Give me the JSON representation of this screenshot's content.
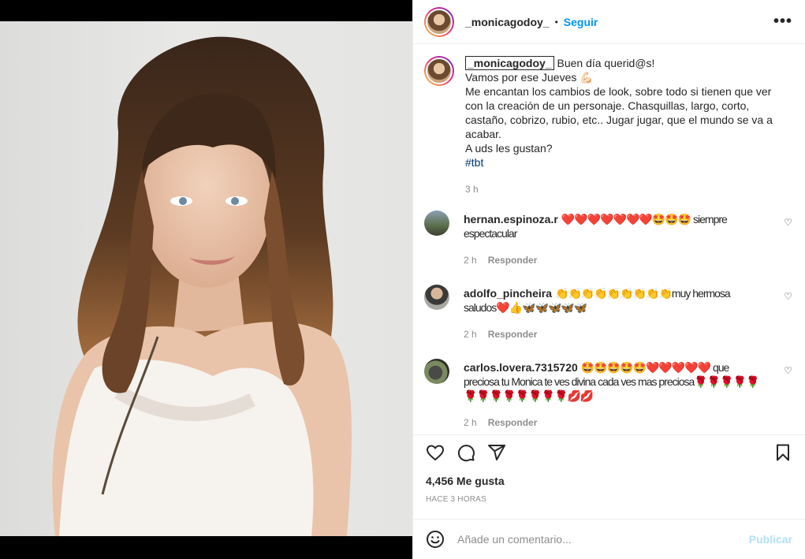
{
  "post": {
    "username": "_monicagodoy_",
    "follow_label": "Seguir",
    "more_label": "•••",
    "caption_lines": [
      "Buen día querid@s!",
      "Vamos por ese Jueves 💪🏻",
      "Me encantan los cambios de look, sobre todo si tienen que ver con la creación de un personaje. Chasquillas, largo, corto, castaño, cobrizo, rubio, etc.. Jugar jugar, que el mundo se va a acabar.",
      "A uds les gustan?"
    ],
    "hashtag": "#tbt",
    "caption_time": "3 h"
  },
  "comments": [
    {
      "user": "hernan.espinoza.r",
      "text": "❤️❤️❤️❤️❤️❤️❤️🤩🤩🤩 siempre espectacular",
      "time": "2 h",
      "reply": "Responder"
    },
    {
      "user": "adolfo_pincheira",
      "text": "👏👏👏👏👏👏👏👏👏muy hermosa saludos❤️👍🦋🦋🦋🦋🦋",
      "time": "2 h",
      "reply": "Responder"
    },
    {
      "user": "carlos.lovera.7315720",
      "text": "🤩🤩🤩🤩🤩❤️❤️❤️❤️❤️ que preciosa tu Monica te ves divina cada ves mas preciosa🌹🌹🌹🌹🌹🌹🌹🌹🌹🌹🌹🌹🌹💋💋",
      "time": "2 h",
      "reply": "Responder"
    }
  ],
  "footer": {
    "likes": "4,456 Me gusta",
    "posted": "HACE 3 HORAS",
    "comment_placeholder": "Añade un comentario...",
    "publish_label": "Publicar"
  },
  "icons": [
    "heart-icon",
    "comment-icon",
    "share-icon",
    "bookmark-icon",
    "emoji-icon",
    "small-heart-icon"
  ],
  "colors": {
    "link": "#0095f6",
    "publish_disabled": "#b2dffc",
    "muted": "#8e8e8e",
    "hashtag": "#00376b"
  }
}
